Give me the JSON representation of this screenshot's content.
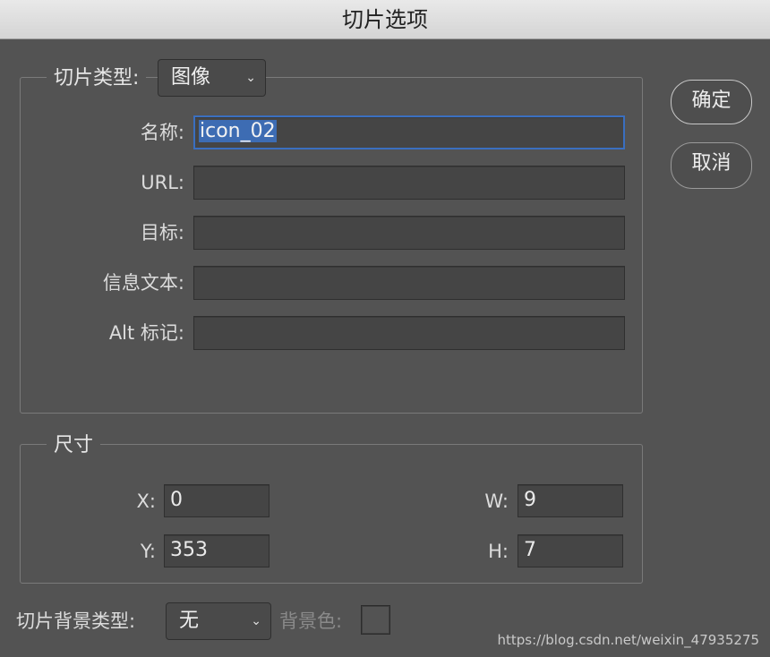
{
  "window": {
    "title": "切片选项"
  },
  "slice": {
    "type_label": "切片类型:",
    "type_value": "图像",
    "name_label": "名称:",
    "name_value": "icon_02",
    "url_label": "URL:",
    "url_value": "",
    "target_label": "目标:",
    "target_value": "",
    "message_label": "信息文本:",
    "message_value": "",
    "alt_label": "Alt 标记:",
    "alt_value": ""
  },
  "dimensions": {
    "legend": "尺寸",
    "x_label": "X:",
    "x_value": "0",
    "y_label": "Y:",
    "y_value": "353",
    "w_label": "W:",
    "w_value": "9",
    "h_label": "H:",
    "h_value": "7"
  },
  "background": {
    "type_label": "切片背景类型:",
    "type_value": "无",
    "color_label": "背景色:"
  },
  "buttons": {
    "ok": "确定",
    "cancel": "取消"
  },
  "watermark": "https://blog.csdn.net/weixin_47935275",
  "icons": {
    "dropdown": "chevron-down-icon"
  },
  "colors": {
    "panel": "#535353",
    "focus": "#3a6fc0",
    "selection": "#3d6cb3"
  }
}
